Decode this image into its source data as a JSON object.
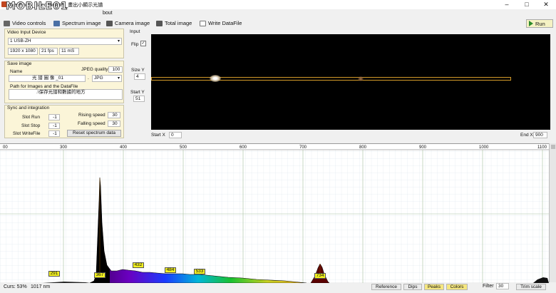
{
  "window": {
    "title": "Theremino_Spectrometer_畫出小顯示光譜"
  },
  "logo": {
    "text": "MOBILE01"
  },
  "menu": {
    "about": "bout"
  },
  "toolbar": {
    "video_controls": "Video controls",
    "spectrum_image": "Spectrum image",
    "camera_image": "Camera image",
    "total_image": "Total image",
    "write_datafile": "Write DataFile",
    "run": "Run"
  },
  "video_input": {
    "title": "Video Input Device",
    "device": "1 USB-ZH",
    "resolution": "1920 x 1080",
    "fps": "21 fps",
    "ms": "11 mS"
  },
  "save_image": {
    "title": "Save image",
    "name_label": "Name",
    "jpeg_quality_label": "JPEG quality",
    "jpeg_quality": "100",
    "name_value": "光 譜 圖 像 _01",
    "dot": ".",
    "format": "JPG",
    "path_label": "Path for Images and the DataFile",
    "path_value": ".\\保存光譜和數據的地方"
  },
  "sync": {
    "title": "Sync and integration",
    "slot_run_label": "Slot Run",
    "slot_run": "-1",
    "slot_stop_label": "Slot Stop",
    "slot_stop": "-1",
    "slot_writefile_label": "Slot WriteFile",
    "slot_writefile": "-1",
    "rising_label": "Rising speed",
    "rising": "30",
    "falling_label": "Falling speed",
    "falling": "30",
    "reset_button": "Reset spectrum data"
  },
  "input": {
    "title": "Input",
    "flip_label": "Flip",
    "flip_checked": true,
    "size_y_label": "Size Y",
    "size_y": "4",
    "start_y_label": "Start Y",
    "start_y": "51",
    "start_x_label": "Start X",
    "start_x": "0",
    "end_x_label": "End X",
    "end_x": "900"
  },
  "spectrum": {
    "axis_ticks": [
      "300",
      "400",
      "500",
      "600",
      "700",
      "800",
      "900",
      "1000",
      "1100"
    ],
    "axis_left_label": "00",
    "peaks": [
      "291",
      "367",
      "432",
      "484",
      "533",
      "734"
    ]
  },
  "status": {
    "curs": "Curs: 53%",
    "nm": "1017 nm",
    "reference": "Reference",
    "dips": "Dips",
    "peaks": "Peaks",
    "colors": "Colors",
    "filter_label": "Filter",
    "filter": "30",
    "trim_scale": "Trim scale"
  },
  "colors": {
    "panel": "#fbf5d8",
    "run": "#f5f2c4",
    "peak_label": "#f2f020",
    "roi": "#d49a2a"
  }
}
